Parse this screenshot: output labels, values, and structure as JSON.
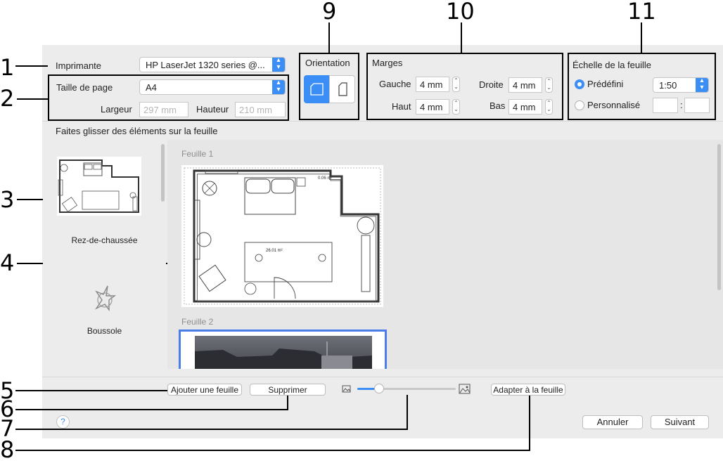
{
  "callouts": [
    "1",
    "2",
    "3",
    "4",
    "5",
    "6",
    "7",
    "8",
    "9",
    "10",
    "11"
  ],
  "printer": {
    "label": "Imprimante",
    "value": "HP LaserJet 1320 series @..."
  },
  "page_size": {
    "label": "Taille de page",
    "value": "A4",
    "width_label": "Largeur",
    "width_value": "297 mm",
    "height_label": "Hauteur",
    "height_value": "210 mm"
  },
  "orientation": {
    "label": "Orientation",
    "landscape_icon": "landscape-page-icon",
    "portrait_icon": "portrait-page-icon"
  },
  "margins": {
    "label": "Marges",
    "left_label": "Gauche",
    "left_value": "4 mm",
    "right_label": "Droite",
    "right_value": "4 mm",
    "top_label": "Haut",
    "top_value": "4 mm",
    "bottom_label": "Bas",
    "bottom_value": "4 mm"
  },
  "scale": {
    "label": "Échelle de la feuille",
    "predefined_label": "Prédéfini",
    "predefined_value": "1:50",
    "custom_label": "Personnalisé",
    "custom_sep": ":"
  },
  "instruction": "Faites glisser des éléments sur la feuille",
  "sidebar": {
    "items": [
      {
        "label": "Rez-de-chaussée",
        "icon": "floor-plan-thumbnail"
      },
      {
        "label": "Boussole",
        "icon": "compass-icon"
      }
    ]
  },
  "sheets": [
    {
      "label": "Feuille 1",
      "room_area": "26.01 m²",
      "small_area": "0.06 m²"
    },
    {
      "label": "Feuille 2"
    }
  ],
  "toolbar": {
    "add_sheet": "Ajouter une feuille",
    "delete": "Supprimer",
    "fit": "Adapter à la feuille",
    "zoom_level": 0.22
  },
  "footer": {
    "help": "?",
    "cancel": "Annuler",
    "next": "Suivant"
  },
  "colors": {
    "accent": "#3a8ef6",
    "dialog_bg": "#ececec",
    "selection": "#4a7de8"
  }
}
